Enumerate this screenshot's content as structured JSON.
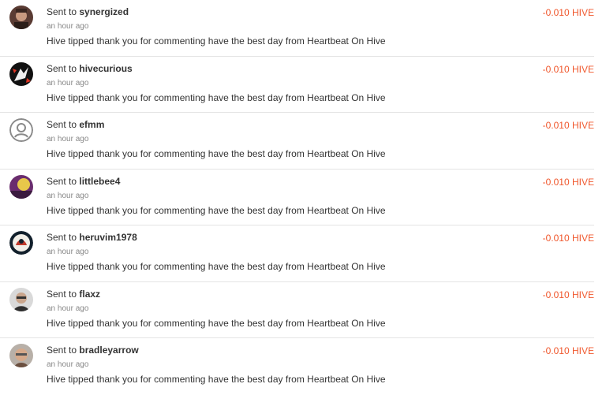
{
  "transactions": [
    {
      "prefix": "Sent to",
      "user": "synergized",
      "time": "an hour ago",
      "memo": "Hive tipped thank you for commenting have the best day from Heartbeat On Hive",
      "amount": "-0.010 HIVE",
      "avatar": "photo-dark-portrait-icon"
    },
    {
      "prefix": "Sent to",
      "user": "hivecurious",
      "time": "an hour ago",
      "memo": "Hive tipped thank you for commenting have the best day from Heartbeat On Hive",
      "amount": "-0.010 HIVE",
      "avatar": "black-red-logo-icon"
    },
    {
      "prefix": "Sent to",
      "user": "efmm",
      "time": "an hour ago",
      "memo": "Hive tipped thank you for commenting have the best day from Heartbeat On Hive",
      "amount": "-0.010 HIVE",
      "avatar": "default-user-icon"
    },
    {
      "prefix": "Sent to",
      "user": "littlebee4",
      "time": "an hour ago",
      "memo": "Hive tipped thank you for commenting have the best day from Heartbeat On Hive",
      "amount": "-0.010 HIVE",
      "avatar": "purple-yellow-photo-icon"
    },
    {
      "prefix": "Sent to",
      "user": "heruvim1978",
      "time": "an hour ago",
      "memo": "Hive tipped thank you for commenting have the best day from Heartbeat On Hive",
      "amount": "-0.010 HIVE",
      "avatar": "dark-circle-logo-icon"
    },
    {
      "prefix": "Sent to",
      "user": "flaxz",
      "time": "an hour ago",
      "memo": "Hive tipped thank you for commenting have the best day from Heartbeat On Hive",
      "amount": "-0.010 HIVE",
      "avatar": "person-photo-icon"
    },
    {
      "prefix": "Sent to",
      "user": "bradleyarrow",
      "time": "an hour ago",
      "memo": "Hive tipped thank you for commenting have the best day from Heartbeat On Hive",
      "amount": "-0.010 HIVE",
      "avatar": "person-photo-icon"
    }
  ],
  "colors": {
    "amount": "#f05a30",
    "divider": "#e4e4e4"
  }
}
